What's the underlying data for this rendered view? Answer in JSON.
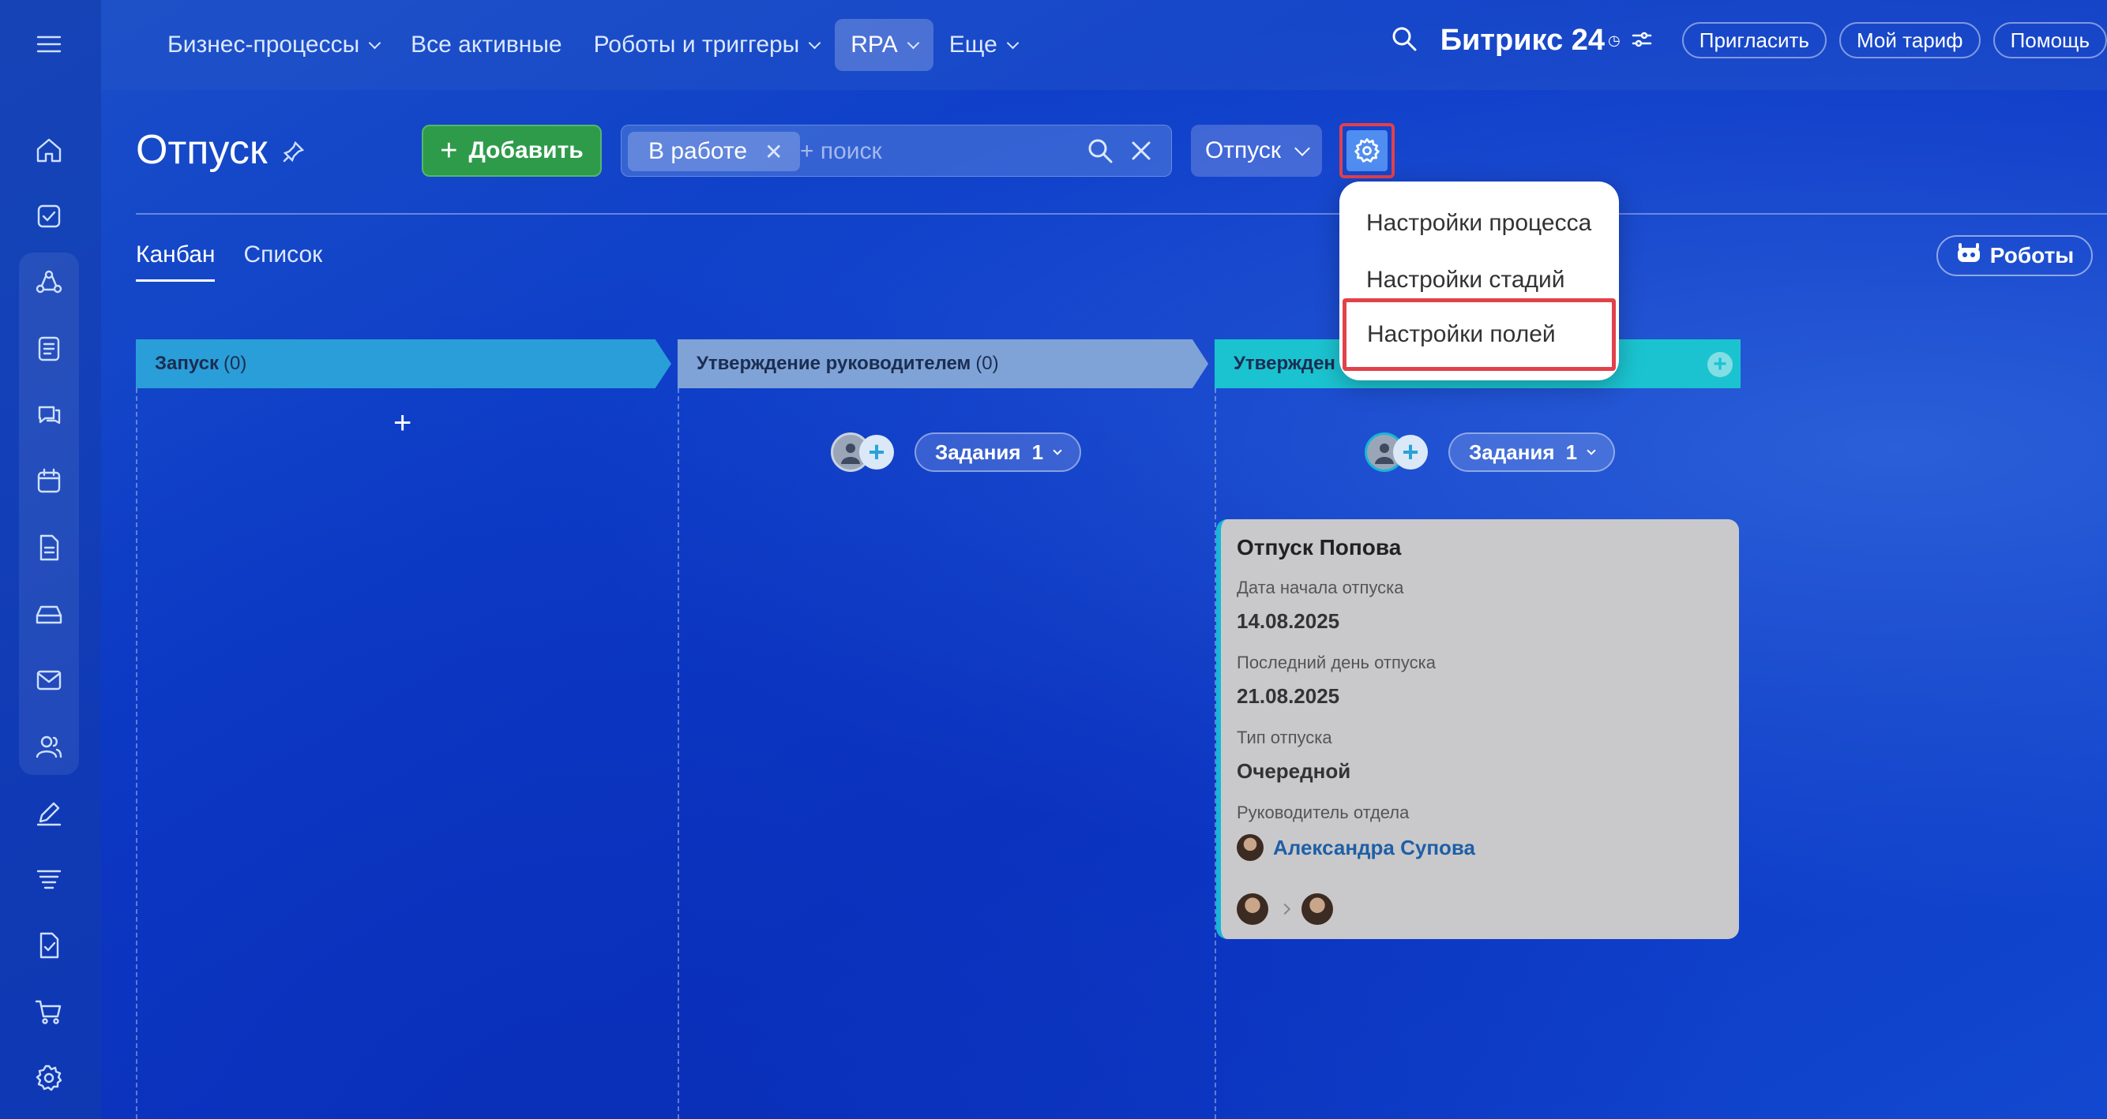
{
  "topnav": {
    "items": [
      {
        "label": "Бизнес-процессы",
        "dropdown": true
      },
      {
        "label": "Все активные",
        "dropdown": false
      },
      {
        "label": "Роботы и триггеры",
        "dropdown": true
      },
      {
        "label": "RPA",
        "dropdown": true,
        "active": true
      },
      {
        "label": "Еще",
        "dropdown": true
      }
    ],
    "brand": "Битрикс 24",
    "invite": "Пригласить",
    "tariff": "Мой тариф",
    "help": "Помощь"
  },
  "page": {
    "title": "Отпуск",
    "add_label": "Добавить",
    "filter_tag": "В работе",
    "search_placeholder": "+ поиск",
    "process_select": "Отпуск"
  },
  "views": {
    "kanban": "Канбан",
    "list": "Список",
    "robots": "Роботы"
  },
  "settings_menu": {
    "process": "Настройки процесса",
    "stages": "Настройки стадий",
    "fields": "Настройки полей"
  },
  "stages": [
    {
      "name": "Запуск",
      "count": "(0)",
      "color": "#2a9ed8"
    },
    {
      "name": "Утверждение руководителем",
      "count": "(0)",
      "color": "#7fa3d6"
    },
    {
      "name": "Утвержден",
      "count": "",
      "color": "#1bc3d0"
    }
  ],
  "tasks": {
    "label": "Задания",
    "count": "1"
  },
  "card": {
    "title": "Отпуск Попова",
    "start_label": "Дата начала отпуска",
    "start_value": "14.08.2025",
    "end_label": "Последний день отпуска",
    "end_value": "21.08.2025",
    "type_label": "Тип отпуска",
    "type_value": "Очередной",
    "manager_label": "Руководитель отдела",
    "manager_value": "Александра Супова"
  },
  "colors": {
    "accent_green": "#2e9b4b",
    "highlight_red": "#e2414a",
    "card_border": "#19b6d6",
    "link_blue": "#1f5fa6"
  }
}
